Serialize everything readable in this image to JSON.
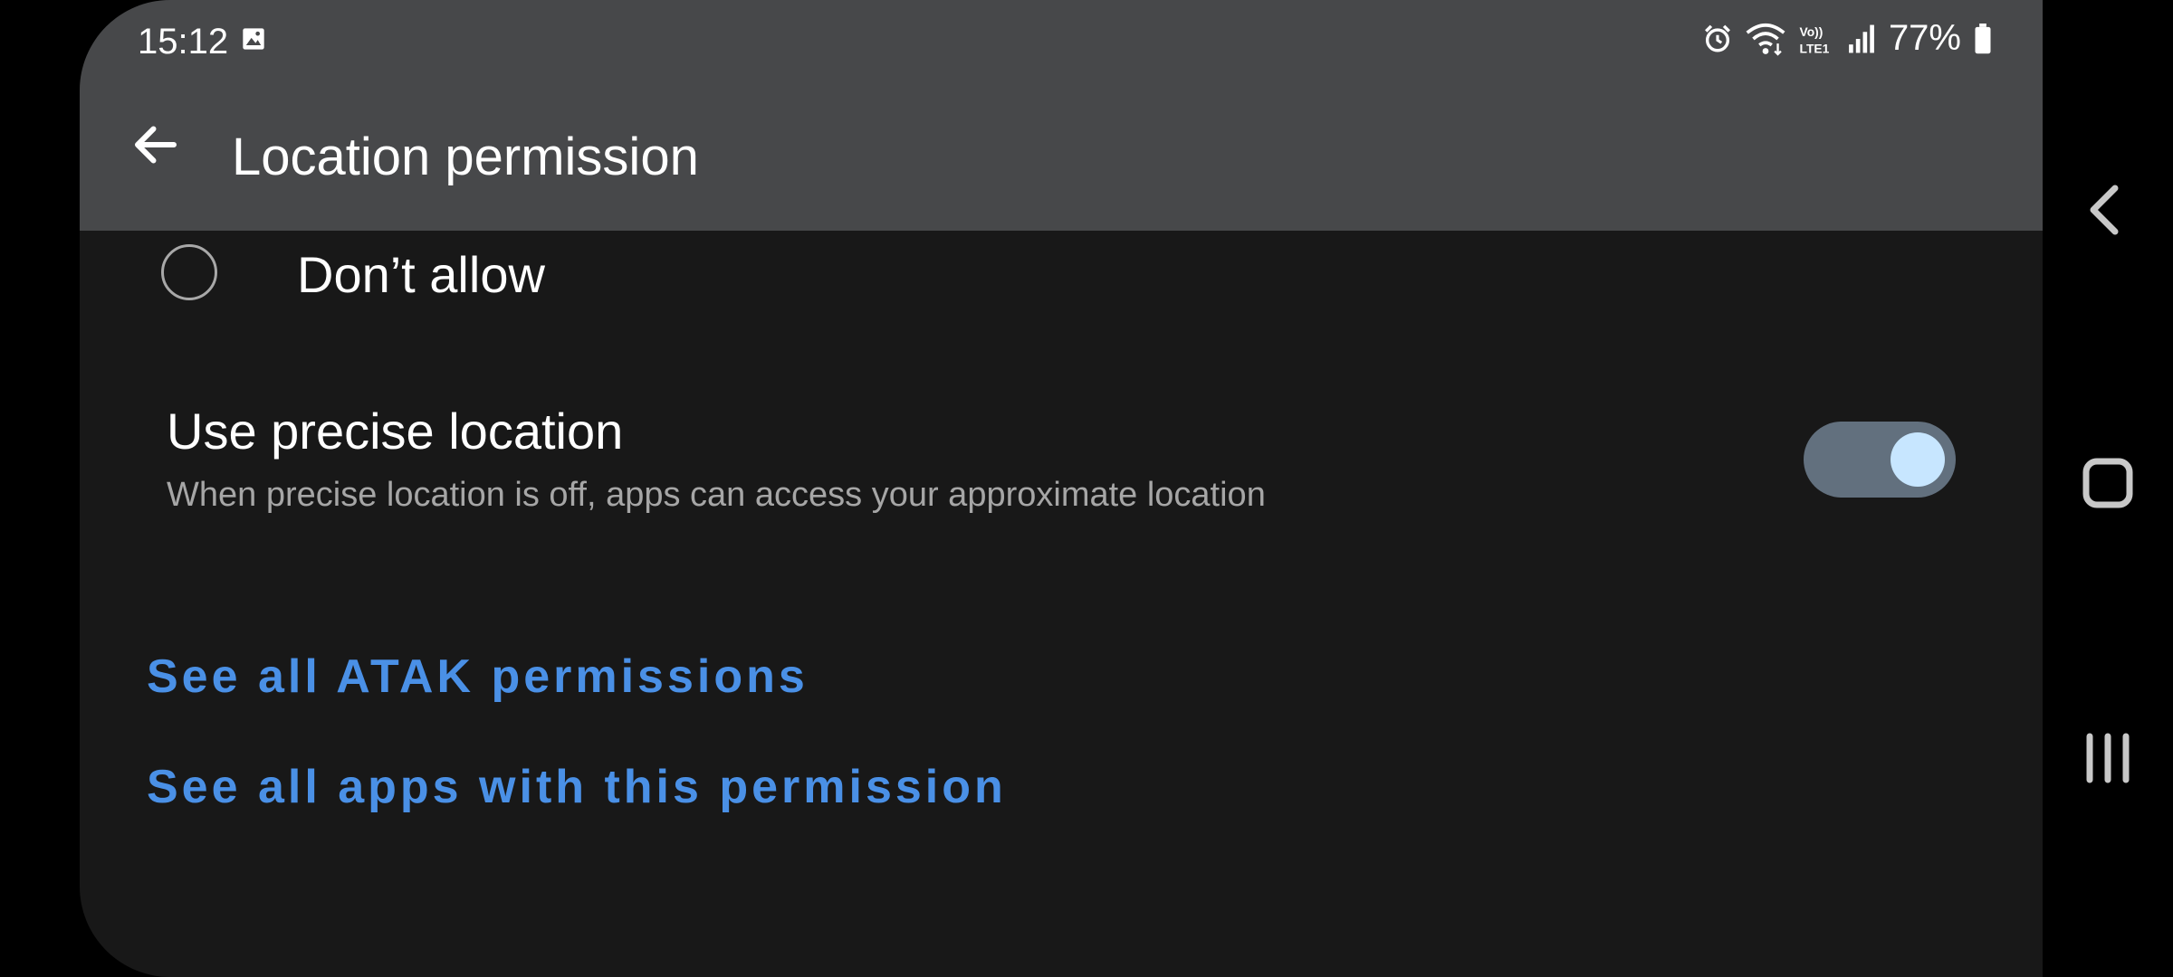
{
  "status_bar": {
    "time": "15:12",
    "battery": "77%",
    "icons": [
      "gallery-icon",
      "alarm-icon",
      "wifi-icon",
      "volte-icon",
      "signal-icon",
      "battery-icon"
    ]
  },
  "header": {
    "title": "Location permission",
    "back_icon": "arrow-left-icon"
  },
  "options": {
    "dont_allow": {
      "label": "Don’t allow",
      "selected": false
    }
  },
  "precise_location": {
    "title": "Use precise location",
    "description": "When precise location is off, apps can access your approximate location",
    "enabled": true
  },
  "links": {
    "atak_permissions": "See all ATAK permissions",
    "apps_with_permission": "See all apps with this permission"
  },
  "nav_bar": {
    "icons": [
      "back-icon",
      "home-icon",
      "recents-icon"
    ]
  },
  "colors": {
    "header_bg": "#47484a",
    "content_bg": "#181818",
    "link": "#4a90e6",
    "toggle_track": "#62707e",
    "toggle_knob": "#c7e6ff"
  }
}
